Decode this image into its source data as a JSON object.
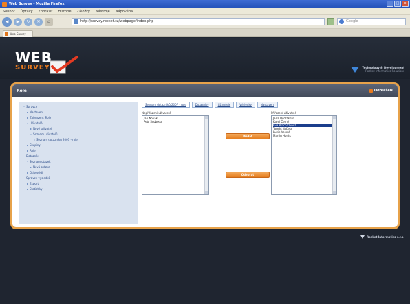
{
  "browser": {
    "window_title": "Web Survey - Mozilla Firefox",
    "menu": [
      "Soubor",
      "Úpravy",
      "Zobrazit",
      "Historie",
      "Záložky",
      "Nástroje",
      "Nápověda"
    ],
    "url": "http://survey.rocket.cz/webpage/index.php",
    "search_placeholder": "Google",
    "tab_label": "Web Survey",
    "win_buttons": [
      "_",
      "□",
      "x"
    ]
  },
  "header": {
    "logo_main": "WEB",
    "logo_sub": "SURVEY",
    "brand_line1": "Technology & Development",
    "brand_line2": "Rocket Informatics Solutions"
  },
  "panel": {
    "title": "Role",
    "logout_label": "Odhlášení"
  },
  "sidebar": {
    "items": [
      {
        "label": "Správce",
        "indent": 0,
        "marker": "–"
      },
      {
        "label": "Nastavení",
        "indent": 1,
        "marker": "▸"
      },
      {
        "label": "Zobrazení: Role",
        "indent": 1,
        "marker": "▸"
      },
      {
        "label": "Uživatelé",
        "indent": 1,
        "marker": "–"
      },
      {
        "label": "Nový uživatel",
        "indent": 2,
        "marker": "▸"
      },
      {
        "label": "Seznam uživatelů",
        "indent": 2,
        "marker": "–"
      },
      {
        "label": "Seznam dotazníků 2007 - role",
        "indent": 3,
        "marker": "▸"
      },
      {
        "label": "Skupiny",
        "indent": 1,
        "marker": "▸"
      },
      {
        "label": "Role",
        "indent": 1,
        "marker": "▸"
      },
      {
        "label": "Dotazník",
        "indent": 0,
        "marker": "–"
      },
      {
        "label": "Seznam otázek",
        "indent": 1,
        "marker": "–"
      },
      {
        "label": "Nová otázka",
        "indent": 2,
        "marker": "▸"
      },
      {
        "label": "Odpovědi",
        "indent": 1,
        "marker": "▸"
      },
      {
        "label": "Správce výsledků",
        "indent": 0,
        "marker": "–"
      },
      {
        "label": "Export",
        "indent": 1,
        "marker": "▸"
      },
      {
        "label": "Statistiky",
        "indent": 1,
        "marker": "▸"
      }
    ]
  },
  "main": {
    "tabs": [
      "Seznam dotazníků 2007 - role",
      "Dotazníky",
      "Uživatelé",
      "Výsledky",
      "Nastavení"
    ],
    "left_list_label": "Nepřiřazení uživatelé",
    "left_list": [
      "Jan Novák",
      "Petr Svoboda"
    ],
    "right_list_label": "Přiřazení uživatelé",
    "right_list": [
      "Jana Dvořáková",
      "Karel Černý",
      "Eva Procházková",
      "Tomáš Kučera",
      "Lucie Veselá",
      "Martin Horák"
    ],
    "right_selected_index": 2,
    "add_button": "Přidat",
    "remove_button": "Odebrat"
  },
  "footer": {
    "brand": "Rocket Informatics s.r.o."
  }
}
